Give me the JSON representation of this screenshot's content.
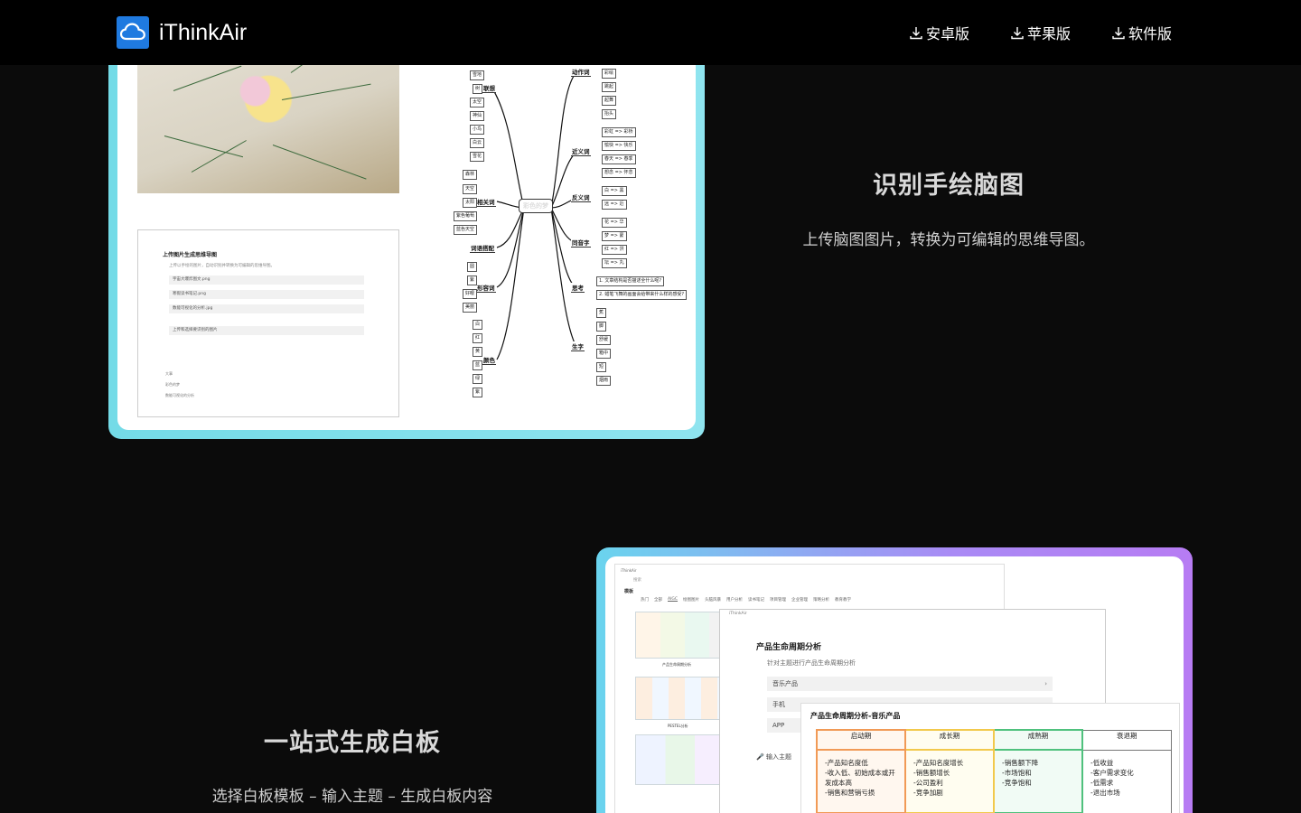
{
  "header": {
    "brand": "iThinkAir",
    "logo_icon": "cloud-icon",
    "downloads": [
      {
        "label": "安卓版",
        "icon": "download-icon"
      },
      {
        "label": "苹果版",
        "icon": "download-icon"
      },
      {
        "label": "软件版",
        "icon": "download-icon"
      }
    ]
  },
  "section1": {
    "title": "识别手绘脑图",
    "desc": "上传脑图图片，转换为可编辑的思维导图。",
    "panel": {
      "title": "上传图片生成思维导图",
      "subtitle": "上传以手绘的图片，自动识别并转换为可编辑的思维导图。",
      "files": [
        "宇宙大爆炸图文.png",
        "寒假读书笔记.png",
        "数能可视化的分析.jpg"
      ],
      "upload": "上传和选择要识别的图片",
      "recent": [
        "大事",
        "彩色的梦",
        "数能可视化的分析"
      ]
    },
    "mindmap": {
      "center": "彩色的梦",
      "left": [
        {
          "label": "联想",
          "leaves": [
            "雪地",
            "树",
            "太空",
            "神仙",
            "小鸟",
            "白云",
            "雪花"
          ]
        },
        {
          "label": "相关词",
          "leaves": [
            "森林",
            "天空",
            "太阳",
            "紫色葡萄",
            "蓝色天空"
          ]
        },
        {
          "label": "词语搭配",
          "leaves": []
        },
        {
          "label": "形容词",
          "leaves": [
            "圆",
            "紫",
            "好眼",
            "美丽"
          ]
        },
        {
          "label": "颜色",
          "leaves": [
            "白",
            "红",
            "黄",
            "蓝",
            "绿",
            "紫"
          ]
        }
      ],
      "right": [
        {
          "label": "动作词",
          "leaves": [
            "彩绘",
            "跳起",
            "起舞",
            "抬头"
          ]
        },
        {
          "label": "近义词",
          "leaves": [
            "彩虹 => 彩桥",
            "愉快 => 快乐",
            "春天 => 春季",
            "想念 => 怀念"
          ]
        },
        {
          "label": "反义词",
          "leaves": [
            "白 => 黑",
            "远 => 近"
          ]
        },
        {
          "label": "同音字",
          "leaves": [
            "花 => 华",
            "梦 => 蒙",
            "红 => 洪",
            "坛 => 丸"
          ]
        },
        {
          "label": "思考",
          "leaves": [
            "1. 文章结构是否描述全什么呢?",
            "2. 蜡笔飞舞的画面会给带来什么样的感受?"
          ]
        },
        {
          "label": "生字",
          "leaves": [
            "蕉",
            "脚",
            "舒缓",
            "箱中",
            "短",
            "烟雨"
          ]
        }
      ]
    }
  },
  "section2": {
    "title": "一站式生成白板",
    "desc": "选择白板模板 – 输入主题 – 生成白板内容",
    "bg_window": {
      "app": "iThinkAir",
      "search": "搜索",
      "heading": "模板",
      "tabs": [
        "热门",
        "全部",
        "AIGC",
        "绘图图片",
        "头脑风暴",
        "用户分析",
        "读书笔记",
        "项目管理",
        "企业管理",
        "策略分析",
        "教育教学"
      ],
      "thumb_labels": [
        "产品生命周期分析",
        "PESTEL分析"
      ]
    },
    "fg_window": {
      "app": "iThinkAir",
      "title": "产品生命周期分析",
      "subtitle": "针对主题进行产品生命周期分析",
      "options": [
        "音乐产品",
        "手机",
        "APP"
      ],
      "input_label": "输入主题"
    },
    "result": {
      "title": "产品生命周期分析-音乐产品",
      "columns": [
        {
          "header": "启动期",
          "items": [
            "-产品知名度低",
            "-收入低、初始成本或开发成本高",
            "-销售和营销亏损"
          ]
        },
        {
          "header": "成长期",
          "items": [
            "-产品知名度增长",
            "-销售额增长",
            "-公司盈利",
            "-竞争加剧"
          ]
        },
        {
          "header": "成熟期",
          "items": [
            "-销售额下降",
            "-市场饱和",
            "-竞争饱和"
          ]
        },
        {
          "header": "衰退期",
          "items": [
            "-低收益",
            "-客户需求变化",
            "-低需求",
            "-退出市场"
          ]
        }
      ]
    }
  }
}
